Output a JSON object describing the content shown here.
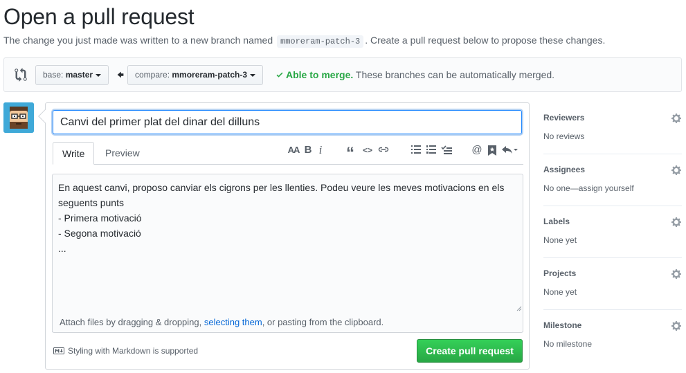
{
  "page": {
    "title": "Open a pull request",
    "subtitle_before": "The change you just made was written to a new branch named ",
    "branch_code": "mmoreram-patch-3",
    "subtitle_after": ". Create a pull request below to propose these changes."
  },
  "range": {
    "base_prefix": "base: ",
    "base_branch": "master",
    "compare_prefix": "compare: ",
    "compare_branch": "mmoreram-patch-3",
    "merge_ok": "Able to merge.",
    "merge_text": " These branches can be automatically merged."
  },
  "form": {
    "title_value": "Canvi del primer plat del dinar del dilluns",
    "tabs": {
      "write": "Write",
      "preview": "Preview"
    },
    "toolbar": {
      "heading": "AA",
      "bold": "B",
      "italic": "i",
      "quote": "“",
      "code": "<>",
      "mention": "@"
    },
    "body_text": "En aquest canvi, proposo canviar els cigrons per les llenties. Podeu veure les meves motivacions en els seguents punts\n- Primera motivació\n- Segona motivació\n...",
    "attach_before": "Attach files by dragging & dropping, ",
    "attach_link": "selecting them",
    "attach_after": ", or pasting from the clipboard.",
    "markdown_note": "Styling with Markdown is supported",
    "submit_label": "Create pull request"
  },
  "sidebar": {
    "reviewers": {
      "label": "Reviewers",
      "value": "No reviews"
    },
    "assignees": {
      "label": "Assignees",
      "value": "No one—assign yourself"
    },
    "labels": {
      "label": "Labels",
      "value": "None yet"
    },
    "projects": {
      "label": "Projects",
      "value": "None yet"
    },
    "milestone": {
      "label": "Milestone",
      "value": "No milestone"
    }
  },
  "colors": {
    "accent_green": "#28a745",
    "link_blue": "#0366d6",
    "focus_blue": "#2188ff",
    "avatar_bg": "#3fa9d8"
  }
}
